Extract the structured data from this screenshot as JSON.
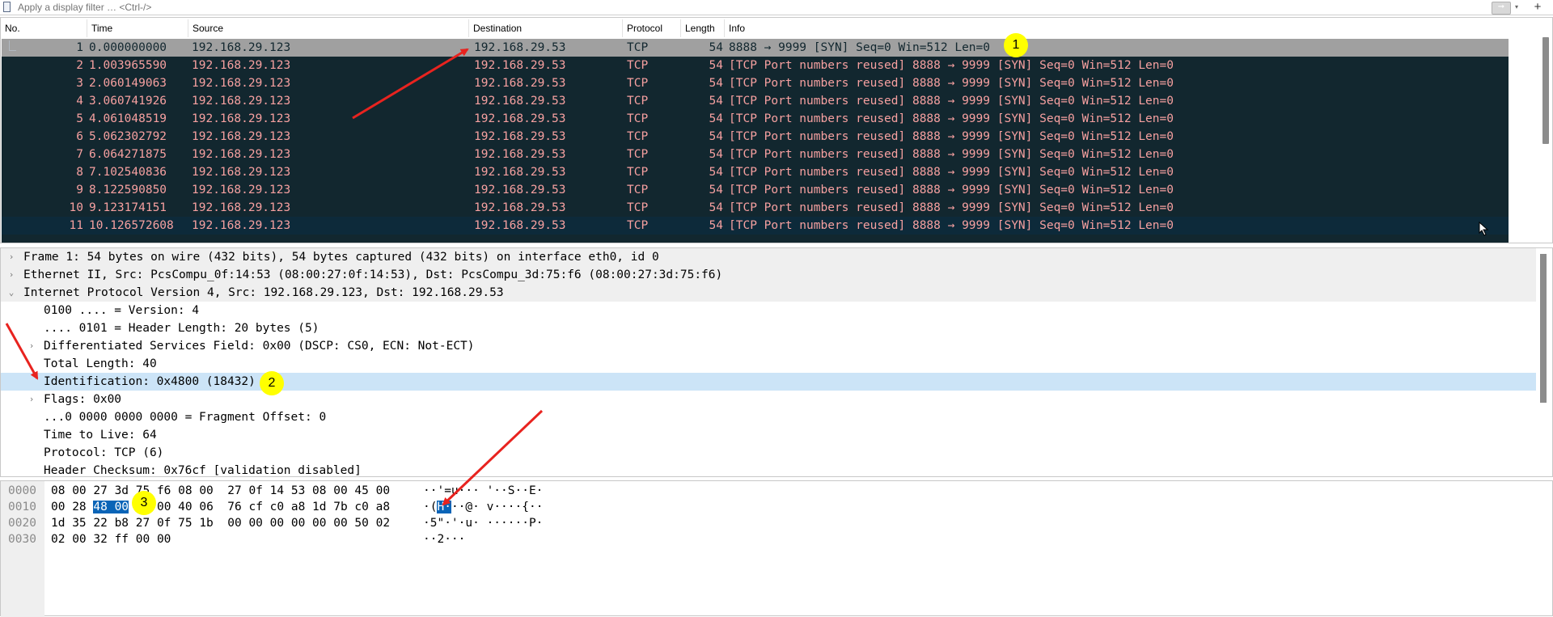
{
  "filter": {
    "placeholder": "Apply a display filter … <Ctrl-/>",
    "apply_icon": "arrow-right-icon",
    "add_label": "+"
  },
  "packet_list": {
    "columns": [
      "No.",
      "Time",
      "Source",
      "Destination",
      "Protocol",
      "Length",
      "Info"
    ],
    "rows": [
      {
        "no": "1",
        "time": "0.000000000",
        "src": "192.168.29.123",
        "dst": "192.168.29.53",
        "proto": "TCP",
        "len": "54",
        "info": "8888 → 9999 [SYN] Seq=0 Win=512 Len=0"
      },
      {
        "no": "2",
        "time": "1.003965590",
        "src": "192.168.29.123",
        "dst": "192.168.29.53",
        "proto": "TCP",
        "len": "54",
        "info": "[TCP Port numbers reused] 8888 → 9999 [SYN] Seq=0 Win=512 Len=0"
      },
      {
        "no": "3",
        "time": "2.060149063",
        "src": "192.168.29.123",
        "dst": "192.168.29.53",
        "proto": "TCP",
        "len": "54",
        "info": "[TCP Port numbers reused] 8888 → 9999 [SYN] Seq=0 Win=512 Len=0"
      },
      {
        "no": "4",
        "time": "3.060741926",
        "src": "192.168.29.123",
        "dst": "192.168.29.53",
        "proto": "TCP",
        "len": "54",
        "info": "[TCP Port numbers reused] 8888 → 9999 [SYN] Seq=0 Win=512 Len=0"
      },
      {
        "no": "5",
        "time": "4.061048519",
        "src": "192.168.29.123",
        "dst": "192.168.29.53",
        "proto": "TCP",
        "len": "54",
        "info": "[TCP Port numbers reused] 8888 → 9999 [SYN] Seq=0 Win=512 Len=0"
      },
      {
        "no": "6",
        "time": "5.062302792",
        "src": "192.168.29.123",
        "dst": "192.168.29.53",
        "proto": "TCP",
        "len": "54",
        "info": "[TCP Port numbers reused] 8888 → 9999 [SYN] Seq=0 Win=512 Len=0"
      },
      {
        "no": "7",
        "time": "6.064271875",
        "src": "192.168.29.123",
        "dst": "192.168.29.53",
        "proto": "TCP",
        "len": "54",
        "info": "[TCP Port numbers reused] 8888 → 9999 [SYN] Seq=0 Win=512 Len=0"
      },
      {
        "no": "8",
        "time": "7.102540836",
        "src": "192.168.29.123",
        "dst": "192.168.29.53",
        "proto": "TCP",
        "len": "54",
        "info": "[TCP Port numbers reused] 8888 → 9999 [SYN] Seq=0 Win=512 Len=0"
      },
      {
        "no": "9",
        "time": "8.122590850",
        "src": "192.168.29.123",
        "dst": "192.168.29.53",
        "proto": "TCP",
        "len": "54",
        "info": "[TCP Port numbers reused] 8888 → 9999 [SYN] Seq=0 Win=512 Len=0"
      },
      {
        "no": "10",
        "time": "9.123174151",
        "src": "192.168.29.123",
        "dst": "192.168.29.53",
        "proto": "TCP",
        "len": "54",
        "info": "[TCP Port numbers reused] 8888 → 9999 [SYN] Seq=0 Win=512 Len=0"
      },
      {
        "no": "11",
        "time": "10.126572608",
        "src": "192.168.29.123",
        "dst": "192.168.29.53",
        "proto": "TCP",
        "len": "54",
        "info": "[TCP Port numbers reused] 8888 → 9999 [SYN] Seq=0 Win=512 Len=0"
      }
    ]
  },
  "details": {
    "rows": [
      {
        "text": "Frame 1: 54 bytes on wire (432 bits), 54 bytes captured (432 bits) on interface eth0, id 0",
        "expander": "›"
      },
      {
        "text": "Ethernet II, Src: PcsCompu_0f:14:53 (08:00:27:0f:14:53), Dst: PcsCompu_3d:75:f6 (08:00:27:3d:75:f6)",
        "expander": "›"
      },
      {
        "text": "Internet Protocol Version 4, Src: 192.168.29.123, Dst: 192.168.29.53",
        "expander": "⌄"
      },
      {
        "text": "0100 .... = Version: 4",
        "expander": ""
      },
      {
        "text": ".... 0101 = Header Length: 20 bytes (5)",
        "expander": ""
      },
      {
        "text": "Differentiated Services Field: 0x00 (DSCP: CS0, ECN: Not-ECT)",
        "expander": "›"
      },
      {
        "text": "Total Length: 40",
        "expander": ""
      },
      {
        "text": "Identification: 0x4800 (18432)",
        "expander": ""
      },
      {
        "text": "Flags: 0x00",
        "expander": "›"
      },
      {
        "text": "...0 0000 0000 0000 = Fragment Offset: 0",
        "expander": ""
      },
      {
        "text": "Time to Live: 64",
        "expander": ""
      },
      {
        "text": "Protocol: TCP (6)",
        "expander": ""
      },
      {
        "text": "Header Checksum: 0x76cf [validation disabled]",
        "expander": ""
      }
    ]
  },
  "bytes": {
    "rows": [
      {
        "offset": "0000",
        "hex_a": "08 00 27 3d 75 f6 08 00",
        "hex_b": "27 0f 14 53 08 00 45 00",
        "ascii": "··'=u··· '··S··E·"
      },
      {
        "offset": "0010",
        "hex_pre": "00 28 ",
        "hex_sel": "48 00",
        "hex_post": " 00 00 40 06",
        "hex_b": "76 cf c0 a8 1d 7b c0 a8",
        "ascii_pre": "·(",
        "ascii_sel": "H·",
        "ascii_post": "··@· v····{··"
      },
      {
        "offset": "0020",
        "hex_a": "1d 35 22 b8 27 0f 75 1b",
        "hex_b": "00 00 00 00 00 00 50 02",
        "ascii": "·5\"·'·u· ······P·"
      },
      {
        "offset": "0030",
        "hex_a": "02 00 32 ff 00 00",
        "hex_b": "",
        "ascii": "··2···"
      }
    ]
  },
  "annotations": {
    "badge1": "1",
    "badge2": "2",
    "badge3": "3",
    "arrow_color": "#e8231f",
    "badge_color": "#ffff00"
  },
  "colors": {
    "list_bg": "#12272f",
    "list_fg": "#f6a0a0",
    "selected_row": "#a0a0a0",
    "highlight": "#cce4f7",
    "byte_sel": "#0a64b7"
  }
}
